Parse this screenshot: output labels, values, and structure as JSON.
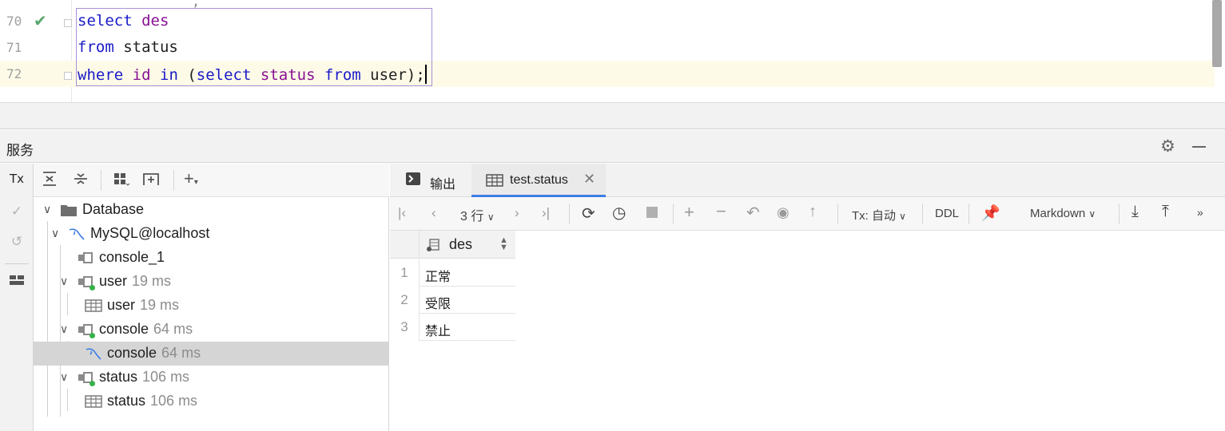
{
  "editor": {
    "lines": [
      {
        "number": "70",
        "status": "check-icon",
        "tokens": [
          [
            "kw",
            "select"
          ],
          [
            "plain",
            " "
          ],
          [
            "id",
            "des"
          ]
        ]
      },
      {
        "number": "71",
        "tokens": [
          [
            "kw",
            "from"
          ],
          [
            "plain",
            " status"
          ]
        ]
      },
      {
        "number": "72",
        "tokens": [
          [
            "kw",
            "where"
          ],
          [
            "plain",
            " "
          ],
          [
            "id",
            "id"
          ],
          [
            "plain",
            " "
          ],
          [
            "kw",
            "in"
          ],
          [
            "plain",
            " ("
          ],
          [
            "kw",
            "select"
          ],
          [
            "plain",
            " "
          ],
          [
            "id",
            "status"
          ],
          [
            "plain",
            " "
          ],
          [
            "kw",
            "from"
          ],
          [
            "plain",
            " user);"
          ]
        ]
      }
    ]
  },
  "services": {
    "title": "服务",
    "left_toolbar": [
      "Tx"
    ],
    "tree": [
      {
        "label": "Database",
        "icon": "folder-icon",
        "expanded": true
      },
      {
        "label": "MySQL@localhost",
        "icon": "mysql-icon",
        "expanded": true
      },
      {
        "label": "console_1",
        "icon": "session-icon"
      },
      {
        "label": "user",
        "ms": "19 ms",
        "icon": "session-icon",
        "expanded": true
      },
      {
        "label": "user",
        "ms": "19 ms",
        "icon": "table-icon"
      },
      {
        "label": "console",
        "ms": "64 ms",
        "icon": "session-icon",
        "expanded": true
      },
      {
        "label": "console",
        "ms": "64 ms",
        "icon": "mysql-icon",
        "selected": true
      },
      {
        "label": "status",
        "ms": "106 ms",
        "icon": "session-icon",
        "expanded": true
      },
      {
        "label": "status",
        "ms": "106 ms",
        "icon": "table-icon"
      }
    ]
  },
  "result": {
    "tabs": [
      {
        "label": "输出",
        "icon": "console-icon"
      },
      {
        "label": "test.status",
        "icon": "table-icon",
        "active": true
      }
    ],
    "toolbar": {
      "rows": "3 行",
      "tx": "Tx: 自动",
      "ddl": "DDL",
      "format": "Markdown"
    },
    "columns": [
      "des"
    ],
    "rows": [
      {
        "num": "1",
        "des": "正常"
      },
      {
        "num": "2",
        "des": "受限"
      },
      {
        "num": "3",
        "des": "禁止"
      }
    ]
  }
}
